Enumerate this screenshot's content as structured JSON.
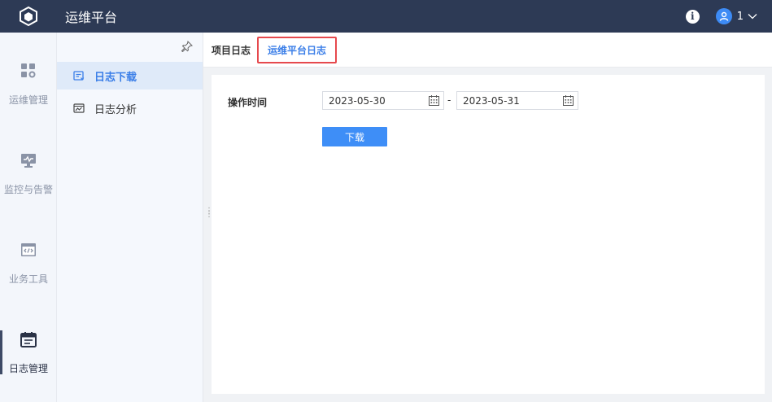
{
  "header": {
    "title": "运维平台",
    "user_name": "1"
  },
  "rail": {
    "items": [
      {
        "label": "运维管理",
        "icon": "grid-settings-icon"
      },
      {
        "label": "监控与告警",
        "icon": "monitor-icon"
      },
      {
        "label": "业务工具",
        "icon": "code-window-icon"
      },
      {
        "label": "日志管理",
        "icon": "calendar-log-icon"
      }
    ],
    "active_index": 3
  },
  "subnav": {
    "items": [
      {
        "label": "日志下载",
        "icon": "log-download-icon"
      },
      {
        "label": "日志分析",
        "icon": "log-analysis-icon"
      }
    ],
    "active_index": 0
  },
  "tabs": [
    {
      "label": "项目日志"
    },
    {
      "label": "运维平台日志"
    }
  ],
  "form": {
    "time_label": "操作时间",
    "start_date": "2023-05-30",
    "end_date": "2023-05-31",
    "separator": "-",
    "download_label": "下载"
  },
  "colors": {
    "header_bg": "#2d3a55",
    "accent": "#3e8ef7",
    "highlight_border": "#e6494d"
  }
}
